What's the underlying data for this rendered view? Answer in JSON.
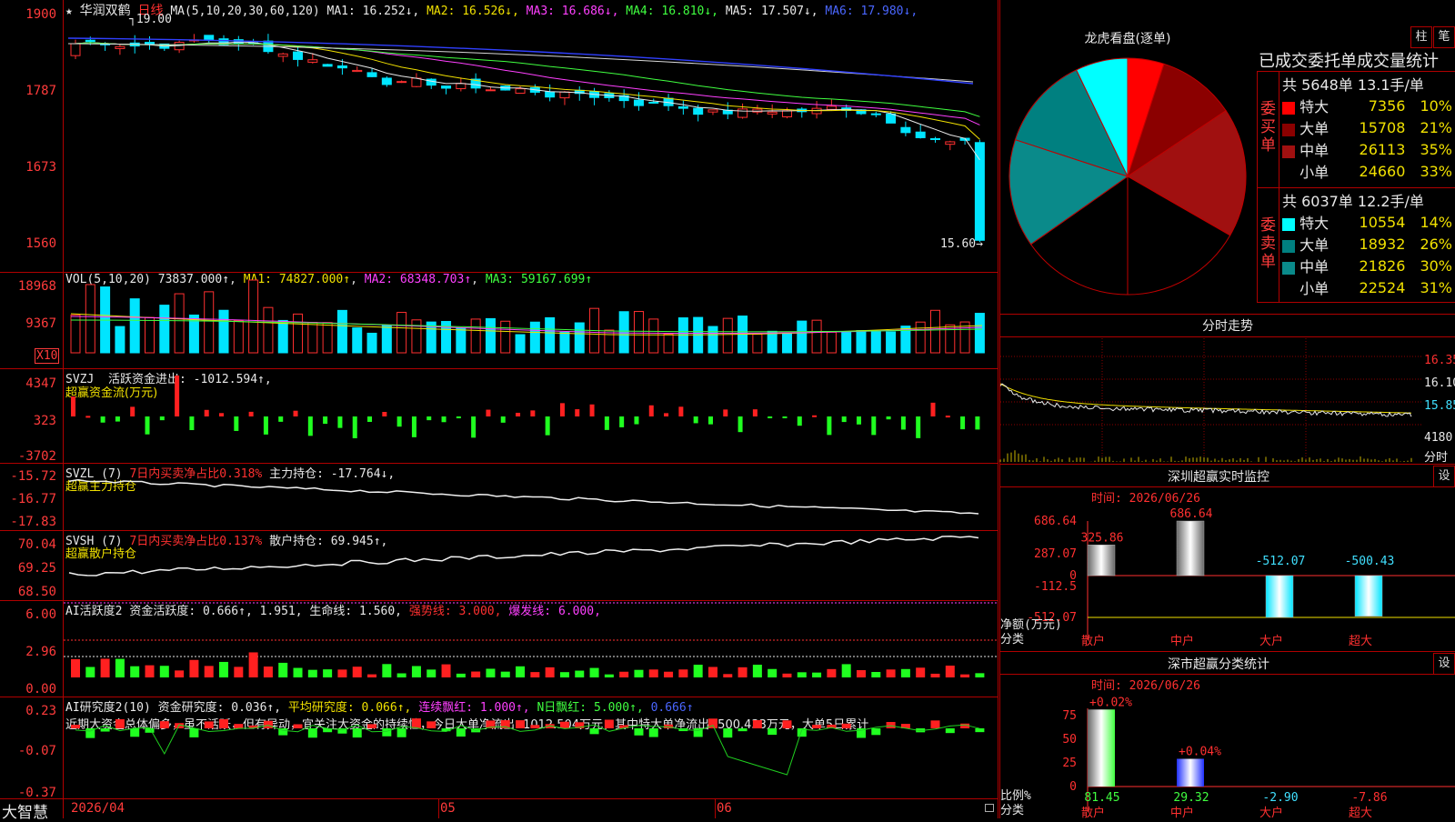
{
  "app": {
    "name": "大智慧"
  },
  "main_chart": {
    "title_star": "★",
    "stock_name": "华润双鹤",
    "period": "日线",
    "ma_params": "MA(5,10,20,30,60,120)",
    "ma_values": [
      {
        "label": "MA1: 16.252↓",
        "color": "#e8e8e8"
      },
      {
        "label": "MA2: 16.526↓",
        "color": "#f0e000"
      },
      {
        "label": "MA3: 16.686↓",
        "color": "#ff40ff"
      },
      {
        "label": "MA4: 16.810↓",
        "color": "#40ff40"
      },
      {
        "label": "MA5: 17.507↓",
        "color": "#e8e8e8"
      },
      {
        "label": "MA6: 17.980↓",
        "color": "#4a66ff"
      }
    ],
    "y_ticks": [
      "1900",
      "1787",
      "1673",
      "1560"
    ],
    "high_label": "19.00",
    "low_label": "15.60"
  },
  "vol_panel": {
    "label": "VOL(5,10,20)",
    "value": "73837.000↑",
    "ma1": "MA1: 74827.000↑",
    "ma2": "MA2: 68348.703↑",
    "ma3": "MA3: 59167.699↑",
    "y_ticks": [
      "18968",
      "9367"
    ],
    "unit": "X10"
  },
  "svzj_panel": {
    "label": "SVZJ",
    "text": "活跃资金进出: -1012.594↑,",
    "subtitle": "超赢资金流(万元)",
    "y_ticks": [
      "4347",
      "323",
      "-3702"
    ]
  },
  "svzl_panel": {
    "label": "SVZL (7)",
    "text1": "7日内买卖净占比0.318%",
    "text2": "主力持仓: -17.764↓,",
    "subtitle": "超赢主力持仓",
    "y_ticks": [
      "-15.72",
      "-16.77",
      "-17.83"
    ]
  },
  "svsh_panel": {
    "label": "SVSH (7)",
    "text1": "7日内买卖净占比0.137%",
    "text2": "散户持仓: 69.945↑,",
    "subtitle": "超赢散户持仓",
    "y_ticks": [
      "70.04",
      "69.25",
      "68.50"
    ]
  },
  "ai_active_panel": {
    "label": "AI活跃度2",
    "t1": "资金活跃度: 0.666↑",
    "t2": ", 1.951,",
    "t3": "生命线: 1.560,",
    "t4": "强势线: 3.000,",
    "t5": "爆发线: 6.000,",
    "y_ticks": [
      "6.00",
      "2.96",
      "0.00"
    ]
  },
  "ai_research_panel": {
    "label": "AI研究度2(10)",
    "t1": "资金研究度: 0.036↑,",
    "t2": "平均研究度: 0.066↑,",
    "t3": "连续飘红: 1.000↑,",
    "t4": "N日飘红: 5.000↑,",
    "t5": "0.666↑",
    "commentary": "近期大资金总体偏多，虽不活跃，但有异动，宜关注大资金的持续性，今日大单净流出:-1012.504万元，其中特大单净流出:-500.433万元，大单5日累计",
    "y_ticks": [
      "0.23",
      "-0.07",
      "-0.37"
    ]
  },
  "x_axis": {
    "labels": [
      "2026/04",
      "05",
      "06"
    ]
  },
  "dragon_tiger": {
    "title": "龙虎看盘(逐单)",
    "btn_bar": "柱",
    "btn_pen": "笔",
    "stats_title": "已成交委托单成交量统计",
    "buy": {
      "group": "委买单",
      "summary": "共 5648单 13.1手/单",
      "rows": [
        {
          "name": "特大",
          "value": "7356",
          "pct": "10%",
          "color": "#ff0000"
        },
        {
          "name": "大单",
          "value": "15708",
          "pct": "21%",
          "color": "#8b0000"
        },
        {
          "name": "中单",
          "value": "26113",
          "pct": "35%",
          "color": "#a01010"
        },
        {
          "name": "小单",
          "value": "24660",
          "pct": "33%",
          "color": "#000000"
        }
      ]
    },
    "sell": {
      "group": "委卖单",
      "summary": "共 6037单 12.2手/单",
      "rows": [
        {
          "name": "特大",
          "value": "10554",
          "pct": "14%",
          "color": "#00ffff"
        },
        {
          "name": "大单",
          "value": "18932",
          "pct": "26%",
          "color": "#008080"
        },
        {
          "name": "中单",
          "value": "21826",
          "pct": "30%",
          "color": "#0a8a8a"
        },
        {
          "name": "小单",
          "value": "22524",
          "pct": "31%",
          "color": "#000000"
        }
      ]
    },
    "chart_data": {
      "type": "pie",
      "categories": [
        "买特大",
        "买大单",
        "买中单",
        "买小单",
        "卖小单",
        "卖中单",
        "卖大单",
        "卖特大"
      ],
      "values": [
        7356,
        15708,
        26113,
        24660,
        22524,
        21826,
        18932,
        10554
      ],
      "colors": [
        "#ff0000",
        "#8b0000",
        "#a01010",
        "#000000",
        "#000000",
        "#0a8a8a",
        "#008080",
        "#00ffff"
      ]
    }
  },
  "intraday": {
    "title": "分时走势",
    "y_ticks": [
      "16.35",
      "16.10",
      "15.85"
    ],
    "vol_label": "4180",
    "corner_label": "分时"
  },
  "sz_monitor": {
    "title": "深圳超赢实时监控",
    "btn": "设",
    "time": "时间: 2026/06/26",
    "y_ticks": [
      "686.64",
      "287.07",
      "0",
      "-112.5",
      "-512.07"
    ],
    "y_label": "净额(万元)",
    "x_label": "分类",
    "chart_data": {
      "type": "bar",
      "categories": [
        "散户",
        "中户",
        "大户",
        "超大"
      ],
      "values": [
        325.86,
        686.64,
        -512.07,
        -500.43
      ],
      "value_labels": [
        "325.86",
        "686.64",
        "-512.07",
        "-500.43"
      ],
      "ylim": [
        -512.07,
        686.64
      ]
    }
  },
  "sz_class": {
    "title": "深市超赢分类统计",
    "btn": "设",
    "time": "时间: 2026/06/26",
    "y_ticks": [
      "75",
      "50",
      "25",
      "0"
    ],
    "y_label": "比例%",
    "x_label": "分类",
    "chart_data": {
      "type": "bar",
      "categories": [
        "散户",
        "中户",
        "大户",
        "超大"
      ],
      "values": [
        81.45,
        29.32,
        -2.9,
        -7.86
      ],
      "change_labels": [
        "+0.02%",
        "+0.04%",
        "",
        ""
      ],
      "value_labels": [
        "81.45",
        "29.32",
        "-2.90",
        "-7.86"
      ],
      "ylim": [
        0,
        75
      ]
    }
  }
}
